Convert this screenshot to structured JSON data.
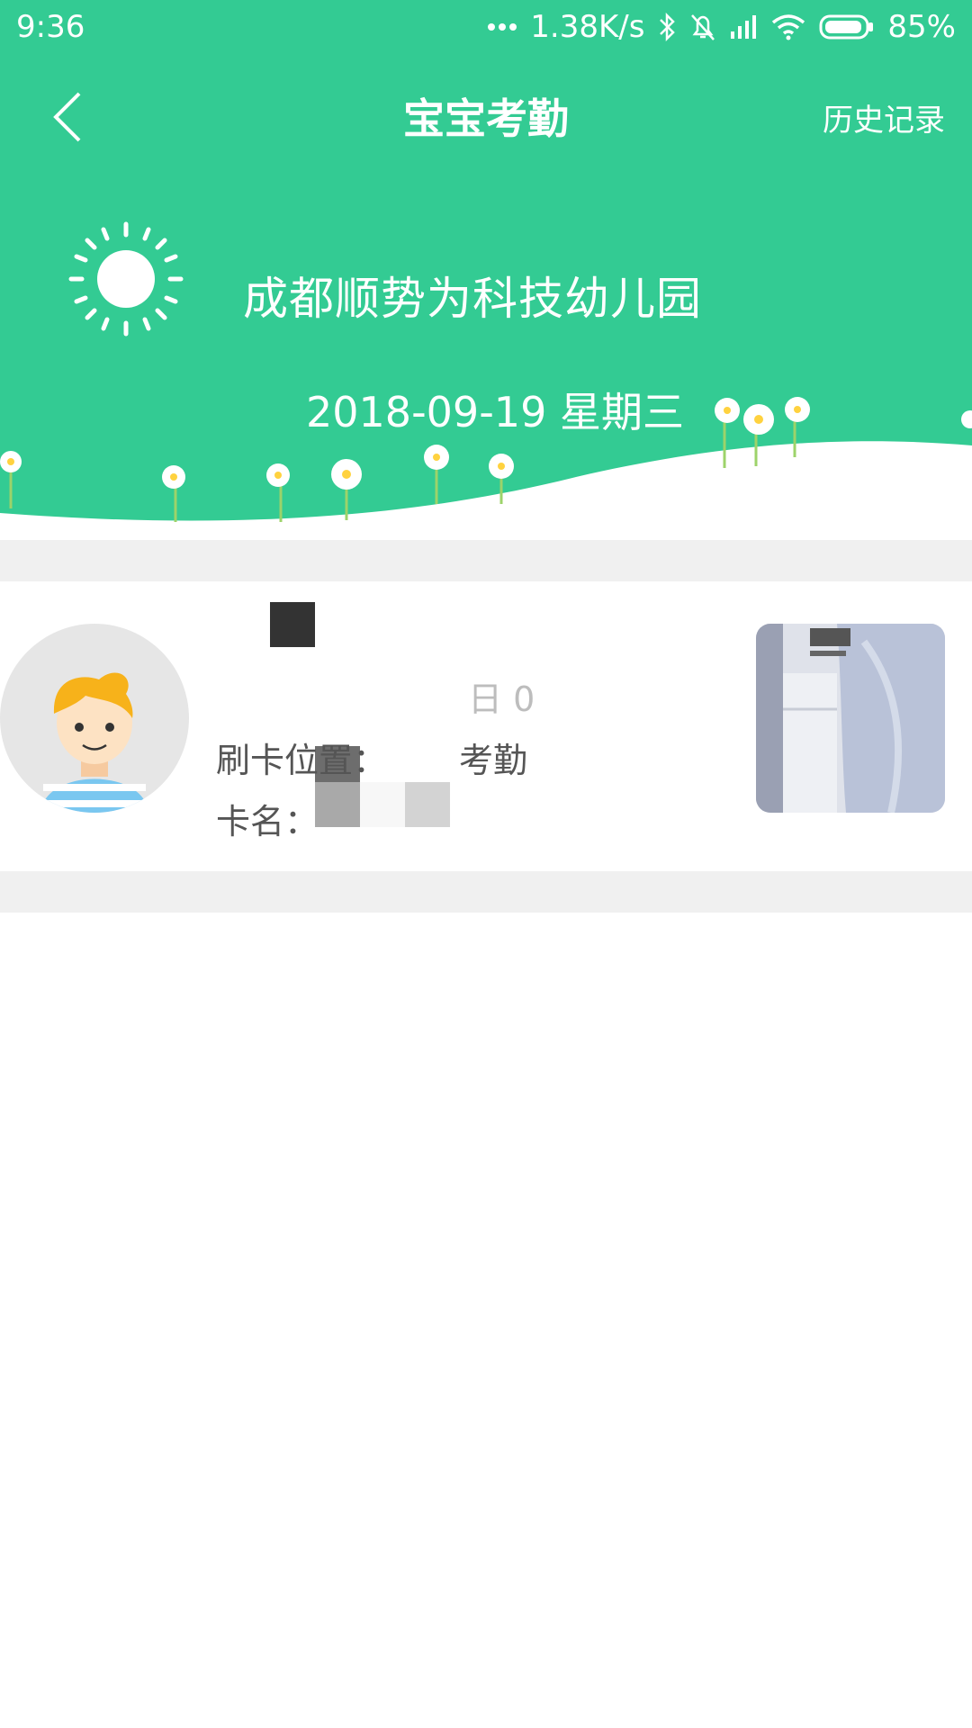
{
  "status_bar": {
    "time": "9:36",
    "network_speed": "1.38K/s",
    "battery": "85%",
    "icons": [
      "more-dots-icon",
      "bluetooth-icon",
      "mute-bell-icon",
      "signal-icon",
      "wifi-icon",
      "battery-icon"
    ]
  },
  "header": {
    "title": "宝宝考勤",
    "history_label": "历史记录",
    "school_name": "成都顺势为科技幼儿园",
    "date": "2018-09-19 星期三",
    "background_color": "#33cb93"
  },
  "record": {
    "time_text": "日 0",
    "location_text": "刷卡位置：",
    "location_suffix": "考勤",
    "card_name_label": "卡名："
  },
  "colors": {
    "accent": "#33cb93",
    "divider": "#f0f0f0"
  }
}
